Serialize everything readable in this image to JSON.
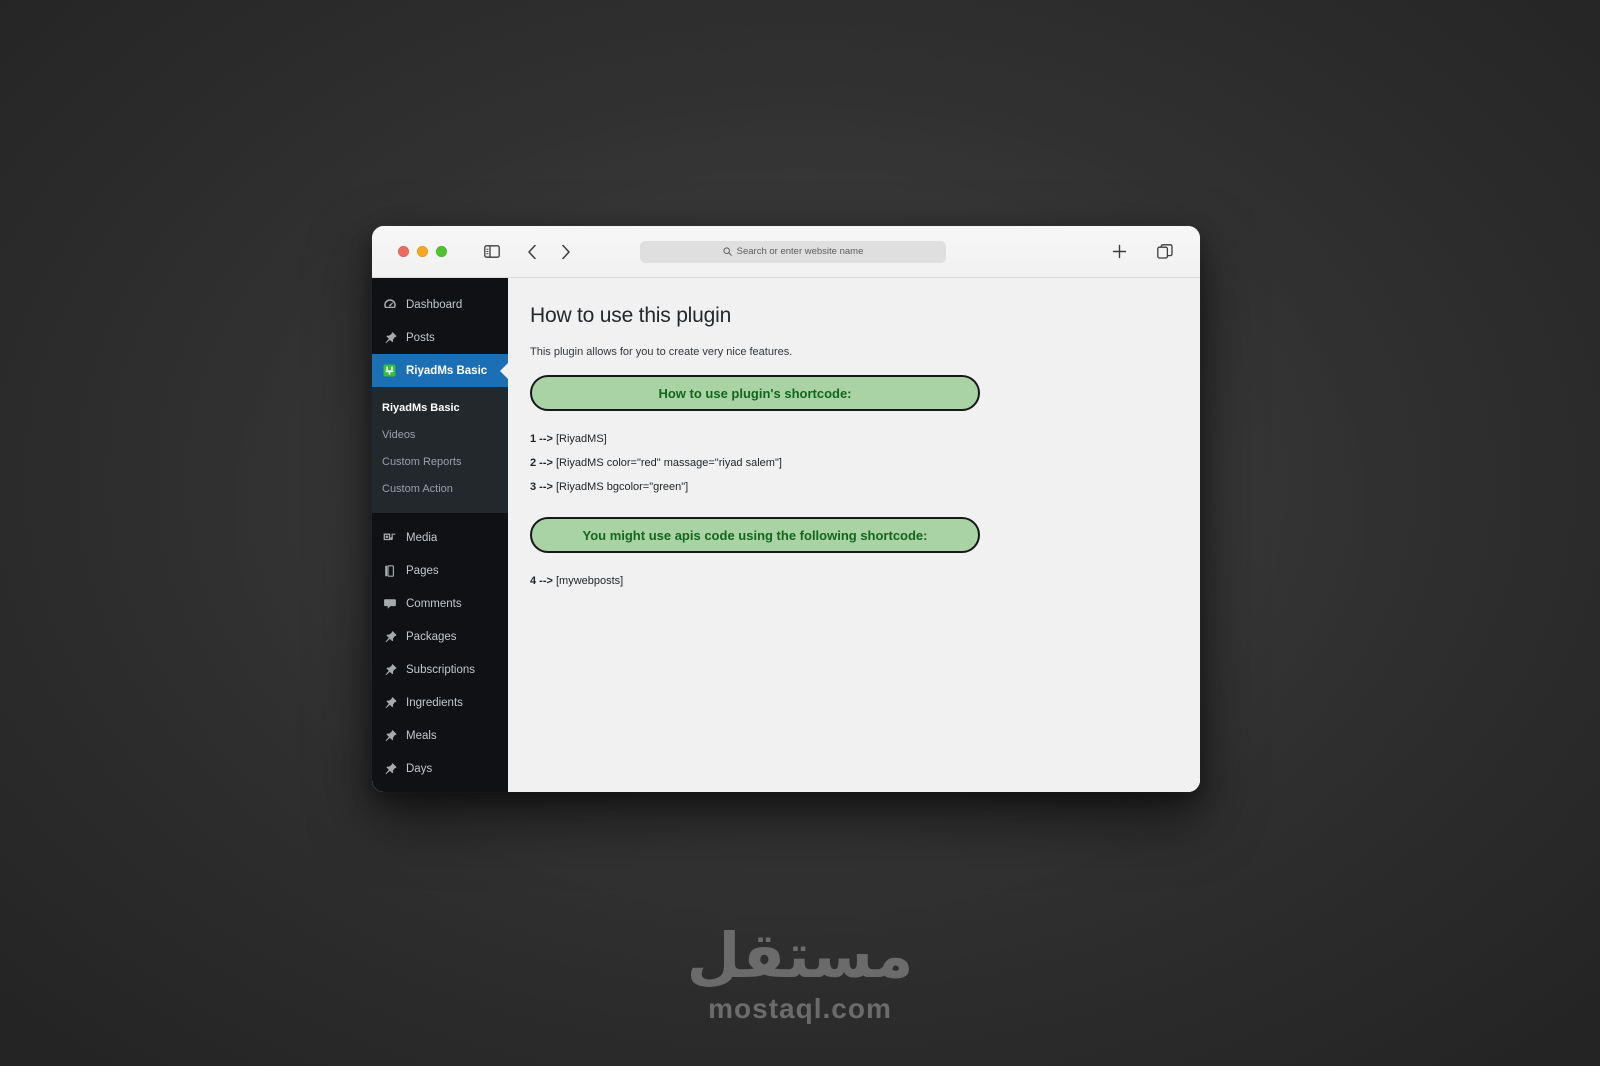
{
  "desktop": {
    "watermark_arabic": "مستقل",
    "watermark_latin": "mostaql.com"
  },
  "browser": {
    "search": {
      "placeholder": "Search or enter website name",
      "value": ""
    },
    "controls": {
      "close_label": "Close",
      "minimize_label": "Minimize",
      "maximize_label": "Maximize",
      "sidebar_toggle_label": "Show Sidebar",
      "back_label": "Back",
      "forward_label": "Forward",
      "new_tab_label": "New Tab",
      "tab_overview_label": "Tab Overview"
    }
  },
  "sidebar": {
    "items": [
      {
        "label": "Dashboard",
        "icon": "dashboard-icon",
        "active": false
      },
      {
        "label": "Posts",
        "icon": "pin-icon",
        "active": false
      },
      {
        "label": "RiyadMs Basic",
        "icon": "plugin-icon",
        "active": true
      }
    ],
    "submenu": [
      {
        "label": "RiyadMs Basic",
        "current": true
      },
      {
        "label": "Videos",
        "current": false
      },
      {
        "label": "Custom Reports",
        "current": false
      },
      {
        "label": "Custom Action",
        "current": false
      }
    ],
    "items_lower": [
      {
        "label": "Media",
        "icon": "media-icon"
      },
      {
        "label": "Pages",
        "icon": "pages-icon"
      },
      {
        "label": "Comments",
        "icon": "comments-icon"
      },
      {
        "label": "Packages",
        "icon": "pin-icon"
      },
      {
        "label": "Subscriptions",
        "icon": "pin-icon"
      },
      {
        "label": "Ingredients",
        "icon": "pin-icon"
      },
      {
        "label": "Meals",
        "icon": "pin-icon"
      },
      {
        "label": "Days",
        "icon": "pin-icon"
      }
    ],
    "colors": {
      "background": "#0f1114",
      "submenu_background": "#23282d",
      "active": "#1a6fb5"
    }
  },
  "main": {
    "title": "How to use this plugin",
    "intro": "This plugin allows for you to create very nice features.",
    "banner_one": "How to use plugin's shortcode:",
    "banner_two": "You might use apis code using the following shortcode:",
    "shortcodes": [
      {
        "num": "1 --> ",
        "code": "[RiyadMS]"
      },
      {
        "num": "2 --> ",
        "code": "[RiyadMS color=\"red\" massage=\"riyad salem\"]"
      },
      {
        "num": "3 --> ",
        "code": "[RiyadMS bgcolor=\"green\"]"
      }
    ],
    "shortcodes_api": [
      {
        "num": "4 --> ",
        "code": "[mywebposts]"
      }
    ],
    "colors": {
      "banner_fill": "#a9d3a5",
      "banner_text": "#14661f",
      "banner_border": "#16181a",
      "content_background": "#f1f1f1"
    }
  }
}
